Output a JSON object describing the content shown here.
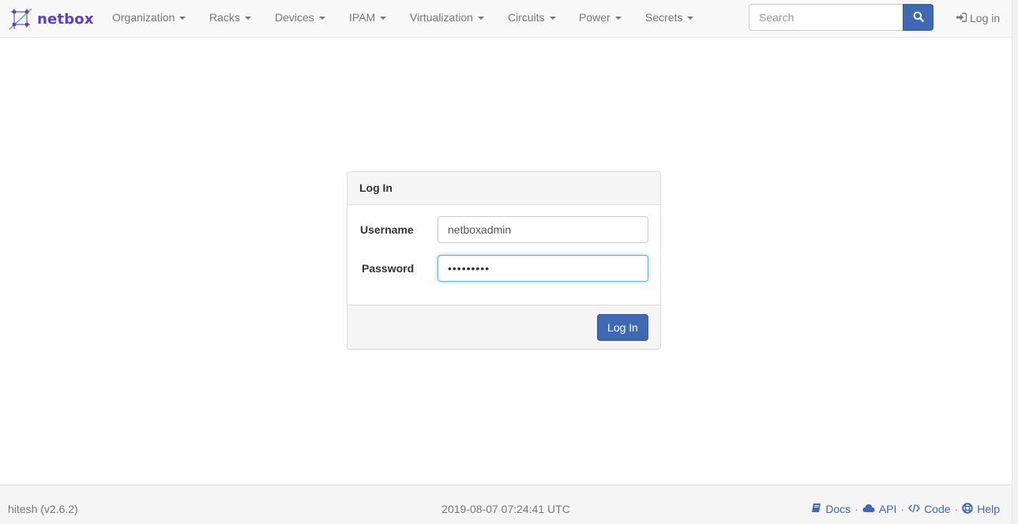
{
  "brand": {
    "name": "netbox",
    "color": "#5b3bd6"
  },
  "nav": {
    "items": [
      {
        "label": "Organization"
      },
      {
        "label": "Racks"
      },
      {
        "label": "Devices"
      },
      {
        "label": "IPAM"
      },
      {
        "label": "Virtualization"
      },
      {
        "label": "Circuits"
      },
      {
        "label": "Power"
      },
      {
        "label": "Secrets"
      }
    ],
    "search_placeholder": "Search",
    "search_icon": "search-icon",
    "login_label": "Log in",
    "login_icon": "sign-in-icon"
  },
  "login_panel": {
    "heading": "Log In",
    "username_label": "Username",
    "username_value": "netboxadmin",
    "password_label": "Password",
    "password_value": "•••••••••",
    "submit_label": "Log In"
  },
  "footer": {
    "left": "hitesh (v2.6.2)",
    "center": "2019-08-07 07:24:41 UTC",
    "links": [
      {
        "label": "Docs",
        "icon": "book-icon"
      },
      {
        "label": "API",
        "icon": "cloud-icon"
      },
      {
        "label": "Code",
        "icon": "code-icon"
      },
      {
        "label": "Help",
        "icon": "life-ring-icon"
      }
    ],
    "separator": "·"
  },
  "colors": {
    "accent": "#3f68b5",
    "navbar_bg": "#f8f8f8",
    "link": "#3f68b5"
  }
}
